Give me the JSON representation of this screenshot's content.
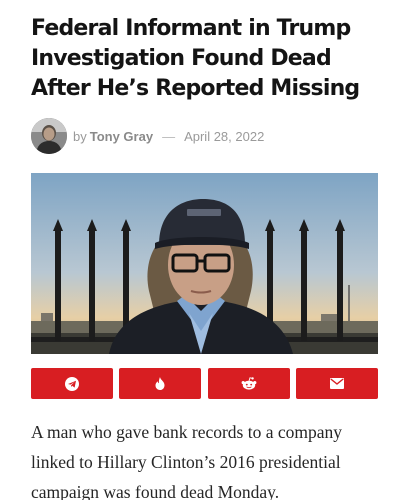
{
  "article": {
    "headline": "Federal Informant in Trump Investigation Found Dead After He’s Reported Missing",
    "byline": {
      "prefix": "by",
      "author": "Tony Gray",
      "separator": "—",
      "date": "April 28, 2022"
    },
    "lead_paragraph": "A man who gave bank records to a company linked to Hillary Clinton’s 2016 presidential campaign was found dead Monday."
  },
  "share_buttons": [
    {
      "icon": "telegram-icon"
    },
    {
      "icon": "tinder-flame-icon"
    },
    {
      "icon": "reddit-icon"
    },
    {
      "icon": "email-icon"
    }
  ],
  "colors": {
    "share_button_bg": "#d81e22",
    "headline": "#141414",
    "meta_text": "#9a9a9a"
  }
}
